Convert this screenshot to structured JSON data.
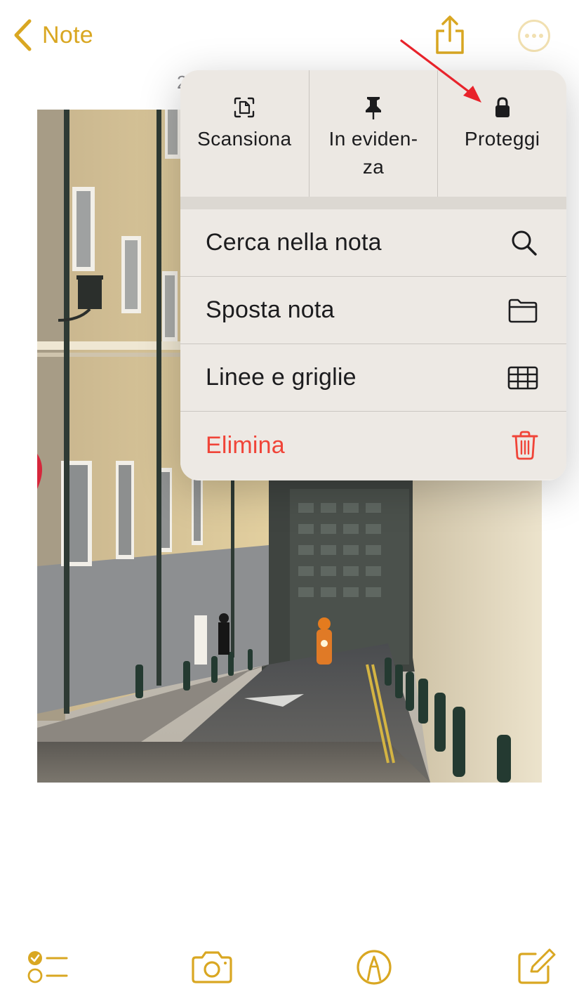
{
  "nav": {
    "back_label": "Note",
    "date_fragment": "2"
  },
  "menu": {
    "top_actions": [
      {
        "label": "Scansiona",
        "icon": "scan-document-icon"
      },
      {
        "label": "In eviden-\nza",
        "icon": "pin-icon"
      },
      {
        "label": "Proteggi",
        "icon": "lock-icon"
      }
    ],
    "rows": [
      {
        "label": "Cerca nella nota",
        "icon": "search-icon"
      },
      {
        "label": "Sposta nota",
        "icon": "folder-icon"
      },
      {
        "label": "Linee e griglie",
        "icon": "grid-icon"
      },
      {
        "label": "Elimina",
        "icon": "trash-icon",
        "destructive": true
      }
    ]
  },
  "toolbar": {
    "items": [
      {
        "icon": "checklist-icon"
      },
      {
        "icon": "camera-icon"
      },
      {
        "icon": "markup-pen-icon"
      },
      {
        "icon": "compose-icon"
      }
    ]
  },
  "colors": {
    "accent": "#d9a722",
    "danger": "#f04438",
    "annotation": "#e8232b"
  }
}
